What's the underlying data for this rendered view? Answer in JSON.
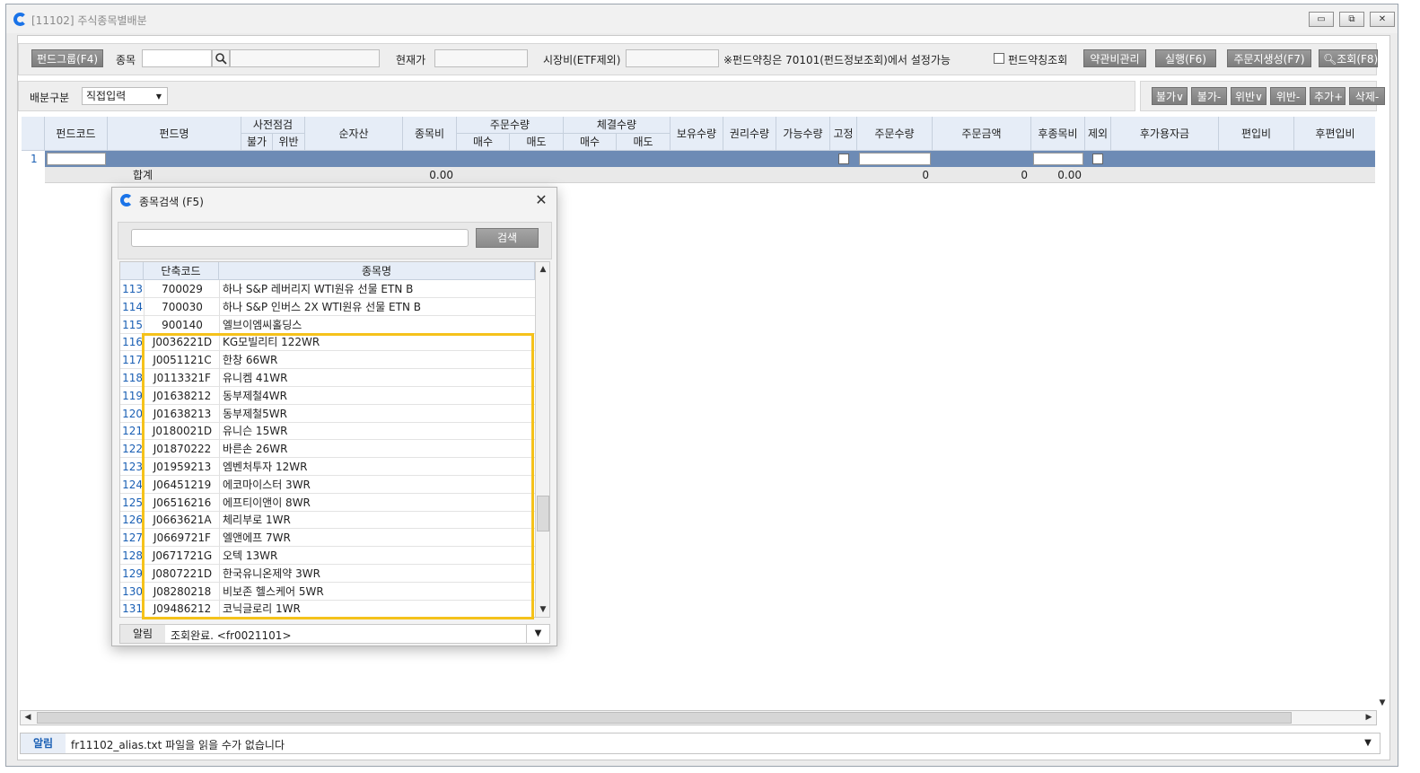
{
  "window": {
    "title": "[11102] 주식종목별배분",
    "controls": [
      "▭",
      "⧉",
      "✕"
    ]
  },
  "toolbar": {
    "fund_group_btn": "펀드그룹(F4)",
    "item_label": "종목",
    "current_price_label": "현재가",
    "market_cost_label": "시장비(ETF제외)",
    "note": "※펀드약칭은 70101(펀드정보조회)에서 설정가능",
    "fund_alias_check_label": "펀드약칭조회",
    "fee_mgmt_btn": "약관비관리",
    "execute_btn": "실행(F6)",
    "order_create_btn": "주문지생성(F7)",
    "search_btn": "조회(F8)"
  },
  "distribution": {
    "label": "배분구분",
    "selected": "직접입력"
  },
  "right_buttons": [
    "불가∨",
    "불가-",
    "위반∨",
    "위반-",
    "추가+",
    "삭제-"
  ],
  "grid": {
    "headers": {
      "fund_code": "펀드코드",
      "fund_name": "펀드명",
      "pre_check": "사전점검",
      "pre_check_no": "불가",
      "pre_check_violation": "위반",
      "net_asset": "순자산",
      "item_ratio": "종목비",
      "order_qty": "주문수량",
      "order_buy": "매수",
      "order_sell": "매도",
      "exec_qty": "체결수량",
      "exec_buy": "매수",
      "exec_sell": "매도",
      "holding_qty": "보유수량",
      "rights_qty": "권리수량",
      "available_qty": "가능수량",
      "fixed": "고정",
      "order_qty2": "주문수량",
      "order_amount": "주문금액",
      "after_item_ratio": "후종목비",
      "exclude": "제외",
      "after_available_fund": "후가용자금",
      "incorporation_ratio": "편입비",
      "after_incorporation_ratio": "후편입비"
    },
    "row_no": "1",
    "sum": {
      "label": "합계",
      "item_ratio": "0.00",
      "order_qty": "0",
      "order_amount": "0",
      "after_item_ratio": "0.00"
    }
  },
  "status": {
    "tag": "알림",
    "message": "fr11102_alias.txt 파일을 읽을 수가 없습니다"
  },
  "dialog": {
    "title": "종목검색 (F5)",
    "search_btn": "검색",
    "col_code": "단축코드",
    "col_name": "종목명",
    "rows": [
      {
        "no": "113",
        "code": "700029",
        "name": "하나 S&P 레버리지 WTI원유 선물 ETN B"
      },
      {
        "no": "114",
        "code": "700030",
        "name": "하나 S&P 인버스 2X WTI원유 선물 ETN B"
      },
      {
        "no": "115",
        "code": "900140",
        "name": "엘브이엠씨홀딩스"
      },
      {
        "no": "116",
        "code": "J0036221D",
        "name": "KG모빌리티 122WR"
      },
      {
        "no": "117",
        "code": "J0051121C",
        "name": "한창 66WR"
      },
      {
        "no": "118",
        "code": "J0113321F",
        "name": "유니켐 41WR"
      },
      {
        "no": "119",
        "code": "J01638212",
        "name": "동부제철4WR"
      },
      {
        "no": "120",
        "code": "J01638213",
        "name": "동부제철5WR"
      },
      {
        "no": "121",
        "code": "J0180021D",
        "name": "유니슨 15WR"
      },
      {
        "no": "122",
        "code": "J01870222",
        "name": "바른손 26WR"
      },
      {
        "no": "123",
        "code": "J01959213",
        "name": "엠벤처투자 12WR"
      },
      {
        "no": "124",
        "code": "J06451219",
        "name": "에코마이스터 3WR"
      },
      {
        "no": "125",
        "code": "J06516216",
        "name": "에프티이앤이 8WR"
      },
      {
        "no": "126",
        "code": "J0663621A",
        "name": "체리부로 1WR"
      },
      {
        "no": "127",
        "code": "J0669721F",
        "name": "엘앤에프 7WR"
      },
      {
        "no": "128",
        "code": "J0671721G",
        "name": "오텍 13WR"
      },
      {
        "no": "129",
        "code": "J0807221D",
        "name": "한국유니온제약 3WR"
      },
      {
        "no": "130",
        "code": "J08280218",
        "name": "비보존 헬스케어 5WR"
      },
      {
        "no": "131",
        "code": "J09486212",
        "name": "코닉글로리 1WR"
      }
    ],
    "status_tag": "알림",
    "status_msg": "조회완료. <fr0021101>"
  }
}
